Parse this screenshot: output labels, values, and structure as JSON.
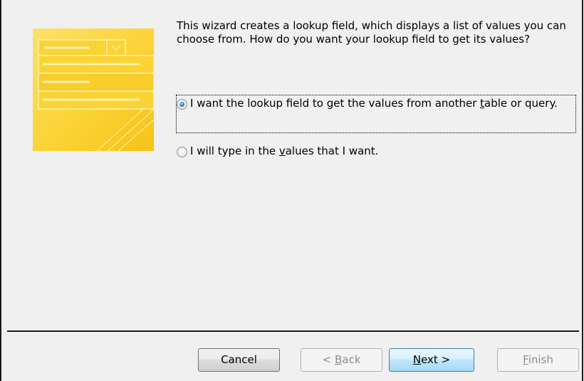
{
  "wizard": {
    "intro": "This wizard creates a lookup field, which displays a list of values you can choose from.  How do you want your lookup field to get its values?",
    "options": [
      {
        "pre": "I want the lookup field to get the values from another ",
        "u": "t",
        "post": "able or query.",
        "checked": true
      },
      {
        "pre": "I will type in the ",
        "u": "v",
        "post": "alues that I want.",
        "checked": false
      }
    ]
  },
  "buttons": {
    "cancel": "Cancel",
    "back": {
      "pre": "< ",
      "u": "B",
      "post": "ack",
      "enabled": false
    },
    "next": {
      "u": "N",
      "post": "ext >",
      "enabled": true
    },
    "finish": {
      "u": "F",
      "post": "inish",
      "enabled": false
    }
  },
  "colors": {
    "dialog_bg": "#f0f0f0",
    "illustration_yellow": "#fbd334",
    "next_button_border": "#3c7fb1",
    "disabled_text": "#8d8d8d"
  }
}
